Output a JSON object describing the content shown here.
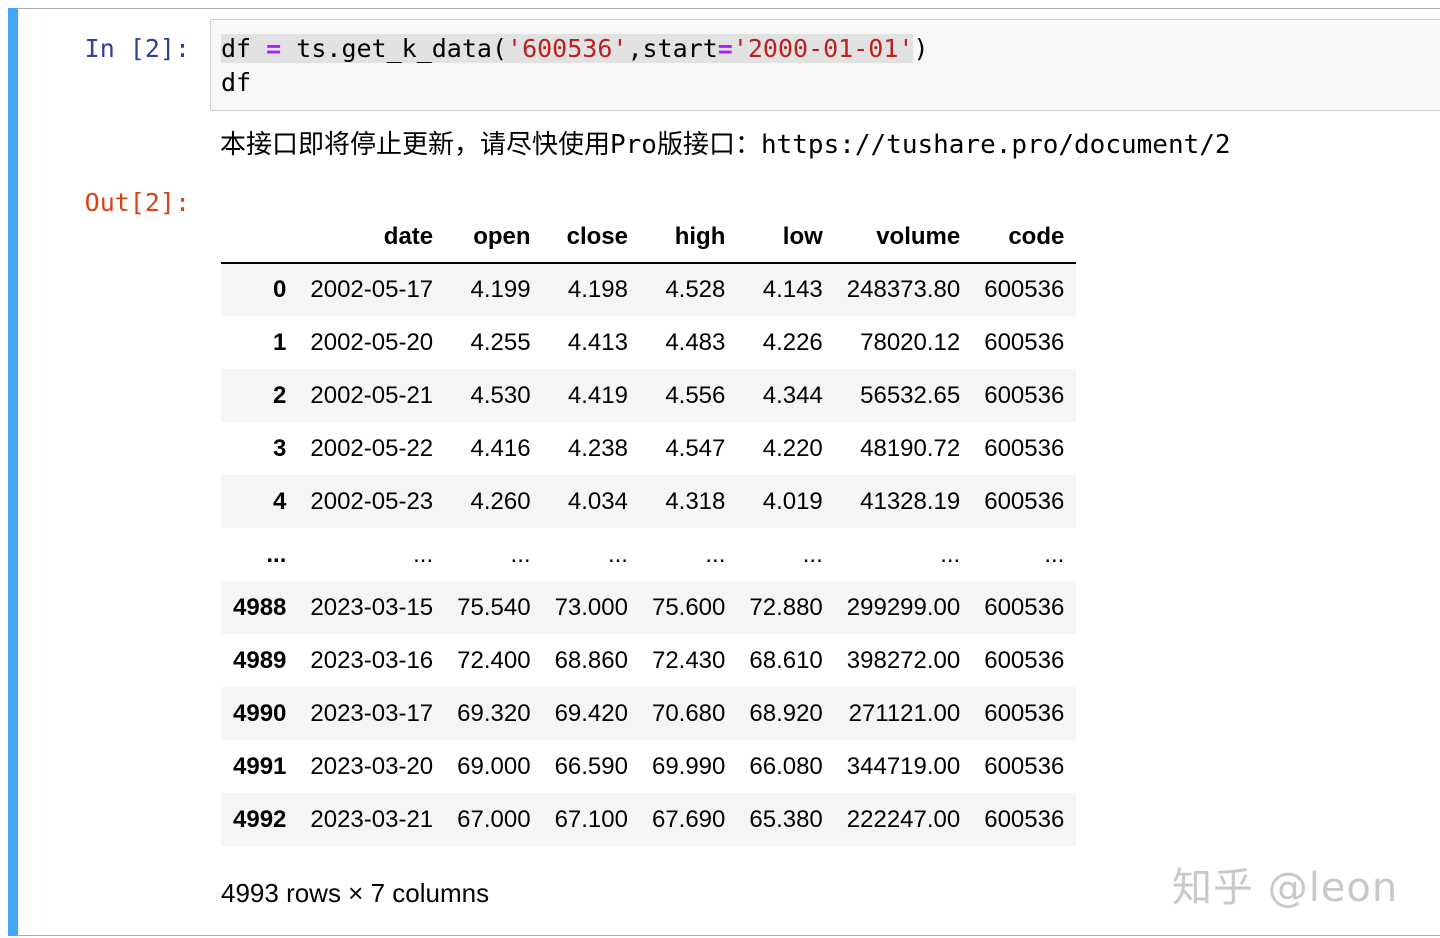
{
  "input_cell": {
    "prompt": "In [2]:",
    "code": {
      "line1": {
        "var": "df",
        "op1": "=",
        "call": "ts.get_k_data(",
        "arg1": "'600536'",
        "kw": ",start",
        "op2": "=",
        "arg2": "'2000-01-01'",
        "close": ")"
      },
      "line2": "df"
    }
  },
  "stderr_message": "本接口即将停止更新，请尽快使用Pro版接口：https://tushare.pro/document/2",
  "output_cell": {
    "prompt": "Out[2]:"
  },
  "dataframe": {
    "columns": [
      "",
      "date",
      "open",
      "close",
      "high",
      "low",
      "volume",
      "code"
    ],
    "rows": [
      [
        "0",
        "2002-05-17",
        "4.199",
        "4.198",
        "4.528",
        "4.143",
        "248373.80",
        "600536"
      ],
      [
        "1",
        "2002-05-20",
        "4.255",
        "4.413",
        "4.483",
        "4.226",
        "78020.12",
        "600536"
      ],
      [
        "2",
        "2002-05-21",
        "4.530",
        "4.419",
        "4.556",
        "4.344",
        "56532.65",
        "600536"
      ],
      [
        "3",
        "2002-05-22",
        "4.416",
        "4.238",
        "4.547",
        "4.220",
        "48190.72",
        "600536"
      ],
      [
        "4",
        "2002-05-23",
        "4.260",
        "4.034",
        "4.318",
        "4.019",
        "41328.19",
        "600536"
      ],
      [
        "...",
        "...",
        "...",
        "...",
        "...",
        "...",
        "...",
        "..."
      ],
      [
        "4988",
        "2023-03-15",
        "75.540",
        "73.000",
        "75.600",
        "72.880",
        "299299.00",
        "600536"
      ],
      [
        "4989",
        "2023-03-16",
        "72.400",
        "68.860",
        "72.430",
        "68.610",
        "398272.00",
        "600536"
      ],
      [
        "4990",
        "2023-03-17",
        "69.320",
        "69.420",
        "70.680",
        "68.920",
        "271121.00",
        "600536"
      ],
      [
        "4991",
        "2023-03-20",
        "69.000",
        "66.590",
        "69.990",
        "66.080",
        "344719.00",
        "600536"
      ],
      [
        "4992",
        "2023-03-21",
        "67.000",
        "67.100",
        "67.690",
        "65.380",
        "222247.00",
        "600536"
      ]
    ],
    "shape_text": "4993 rows × 7 columns"
  },
  "watermark": "知乎 @leon",
  "colors": {
    "cell_bar": "#42a5f5",
    "prompt_in": "#303f9f",
    "prompt_out": "#d84315",
    "string": "#ba2121",
    "operator": "#aa22ff",
    "row_stripe": "#f5f5f5"
  }
}
